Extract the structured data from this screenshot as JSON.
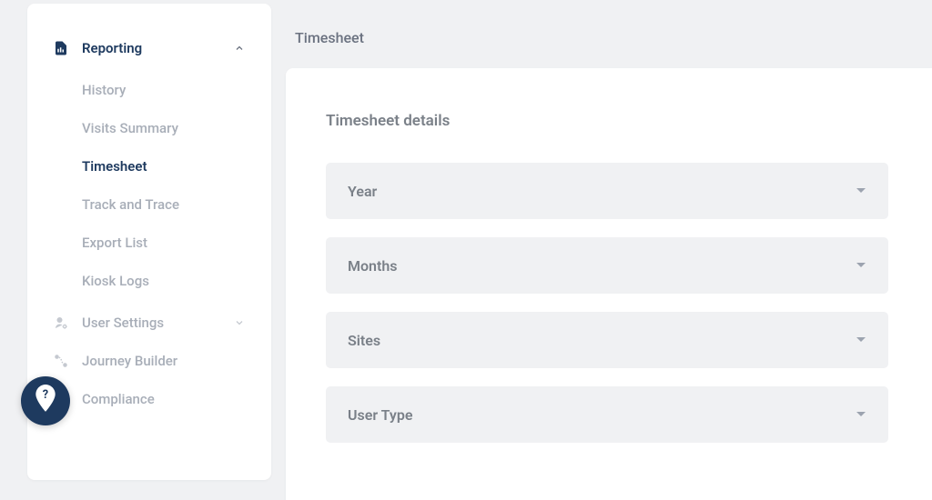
{
  "sidebar": {
    "sections": [
      {
        "label": "Reporting",
        "expanded": true,
        "items": [
          {
            "label": "History"
          },
          {
            "label": "Visits Summary"
          },
          {
            "label": "Timesheet"
          },
          {
            "label": "Track and Trace"
          },
          {
            "label": "Export List"
          },
          {
            "label": "Kiosk Logs"
          }
        ]
      },
      {
        "label": "User Settings"
      },
      {
        "label": "Journey Builder"
      },
      {
        "label": "Compliance"
      }
    ]
  },
  "page": {
    "title": "Timesheet",
    "card_title": "Timesheet details",
    "filters": {
      "year": "Year",
      "months": "Months",
      "sites": "Sites",
      "user_type": "User Type"
    }
  }
}
